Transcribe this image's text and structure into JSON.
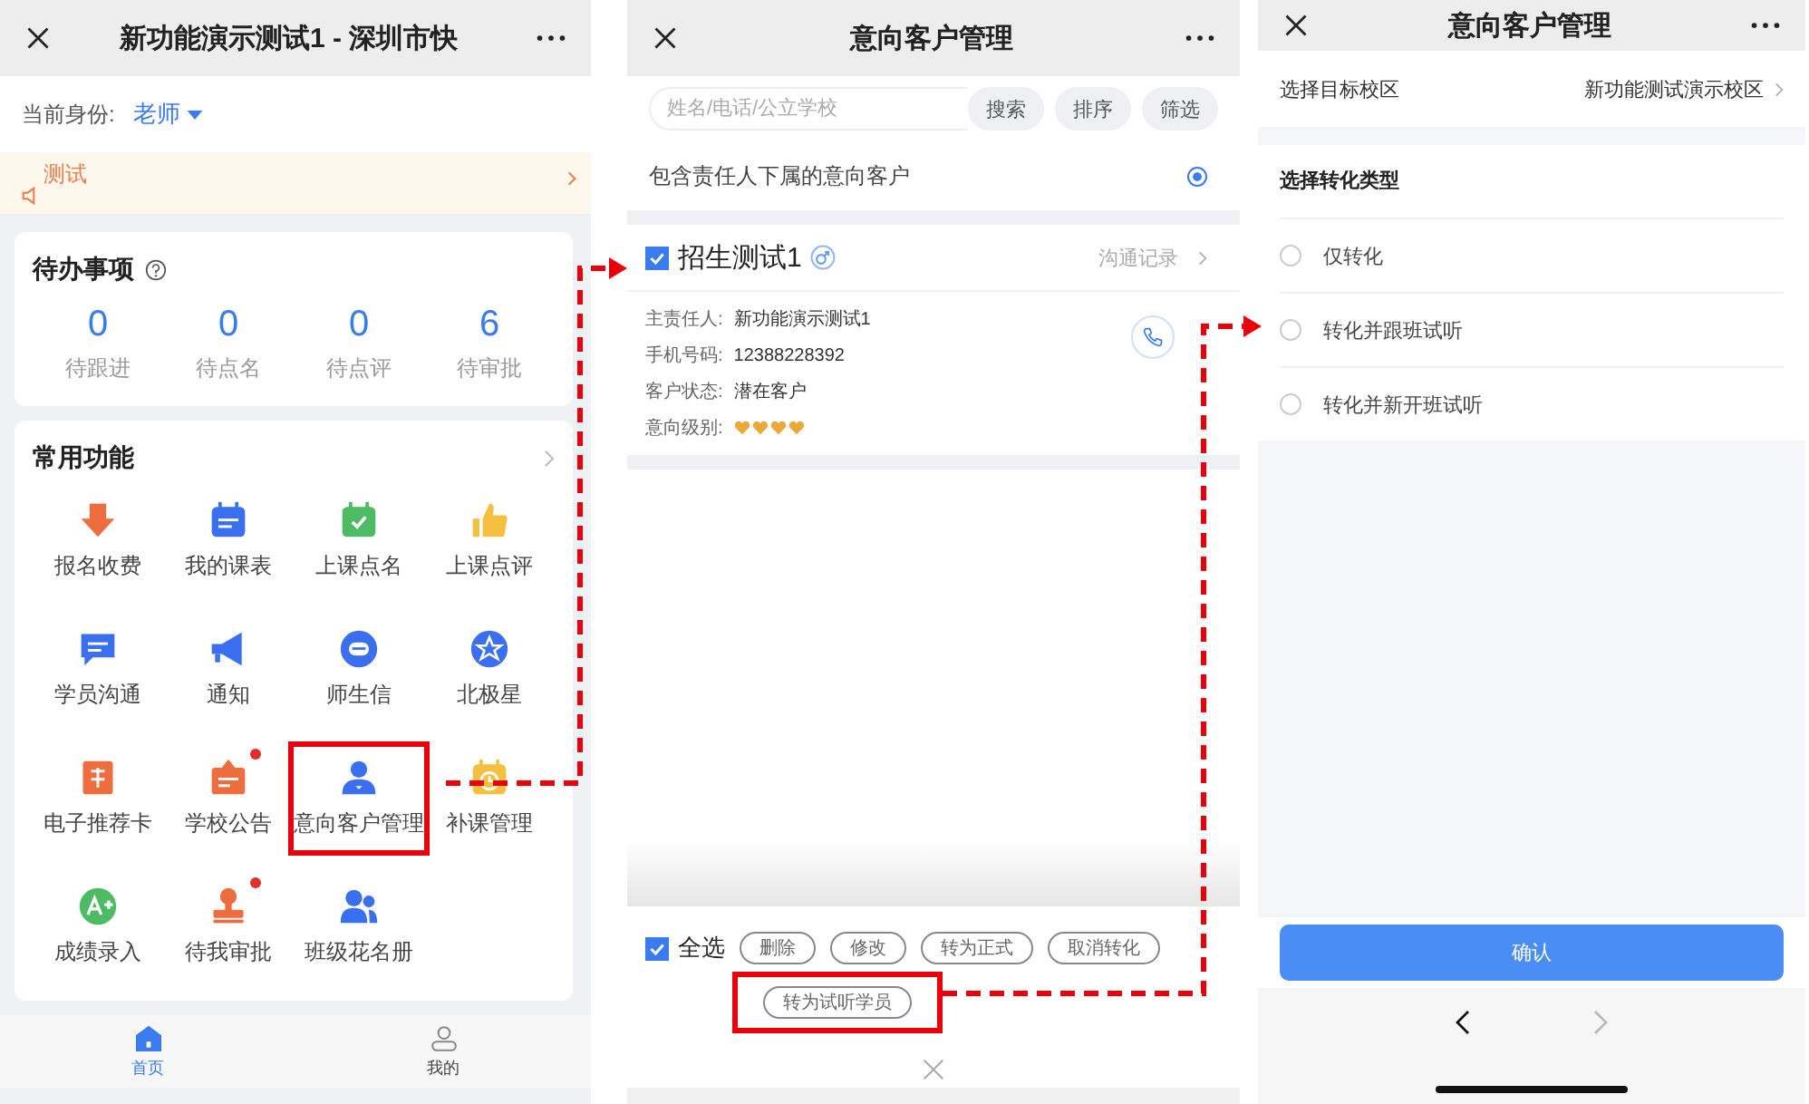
{
  "home_screen": {
    "title": "新功能演示测试1 - 深圳市快",
    "identity_label": "当前身份:",
    "identity_value": "老师",
    "notice": "测试",
    "todo": {
      "title": "待办事项",
      "stats": [
        {
          "value": "0",
          "label": "待跟进"
        },
        {
          "value": "0",
          "label": "待点名"
        },
        {
          "value": "0",
          "label": "待点评"
        },
        {
          "value": "6",
          "label": "待审批"
        }
      ]
    },
    "functions": {
      "title": "常用功能",
      "items": [
        {
          "label": "报名收费",
          "kind": "fee",
          "badge": false,
          "highlighted": false
        },
        {
          "label": "我的课表",
          "kind": "schedule",
          "badge": false,
          "highlighted": false
        },
        {
          "label": "上课点名",
          "kind": "attendance",
          "badge": false,
          "highlighted": false
        },
        {
          "label": "上课点评",
          "kind": "review",
          "badge": false,
          "highlighted": false
        },
        {
          "label": "学员沟通",
          "kind": "chat",
          "badge": false,
          "highlighted": false
        },
        {
          "label": "通知",
          "kind": "notice",
          "badge": false,
          "highlighted": false
        },
        {
          "label": "师生信",
          "kind": "message",
          "badge": false,
          "highlighted": false
        },
        {
          "label": "北极星",
          "kind": "star",
          "badge": false,
          "highlighted": false
        },
        {
          "label": "电子推荐卡",
          "kind": "card",
          "badge": false,
          "highlighted": false
        },
        {
          "label": "学校公告",
          "kind": "board",
          "badge": true,
          "highlighted": false
        },
        {
          "label": "意向客户管理",
          "kind": "person",
          "badge": false,
          "highlighted": true
        },
        {
          "label": "补课管理",
          "kind": "clock",
          "badge": false,
          "highlighted": false
        },
        {
          "label": "成绩录入",
          "kind": "grade",
          "badge": false,
          "highlighted": false
        },
        {
          "label": "待我审批",
          "kind": "stamp",
          "badge": true,
          "highlighted": false
        },
        {
          "label": "班级花名册",
          "kind": "people",
          "badge": false,
          "highlighted": false
        }
      ]
    },
    "tab_bar": [
      {
        "label": "首页",
        "selected": true
      },
      {
        "label": "我的",
        "selected": false
      }
    ]
  },
  "customer_list_screen": {
    "title": "意向客户管理",
    "search": {
      "placeholder": "姓名/电话/公立学校",
      "button": "搜索"
    },
    "tools": [
      "排序",
      "筛选"
    ],
    "include_subordinates": {
      "label": "包含责任人下属的意向客户",
      "on": true
    },
    "customers": [
      {
        "name": "招生测试1",
        "checked": true,
        "link": "沟通记录",
        "fields": [
          {
            "kind": "text",
            "label": "主责任人:",
            "value": "新功能演示测试1"
          },
          {
            "kind": "text",
            "label": "手机号码:",
            "value": "12388228392"
          },
          {
            "kind": "text",
            "label": "客户状态:",
            "value": "潜在客户"
          },
          {
            "kind": "rating",
            "label": "意向级别:",
            "stars": 4
          }
        ]
      }
    ],
    "bulk_bar": {
      "select_all": {
        "label": "全选",
        "checked": true
      },
      "actions": [
        {
          "label": "删除",
          "highlighted": false
        },
        {
          "label": "修改",
          "highlighted": false
        },
        {
          "label": "转为正式",
          "highlighted": false
        },
        {
          "label": "取消转化",
          "highlighted": false
        },
        {
          "label": "转为试听学员",
          "highlighted": true
        }
      ]
    }
  },
  "conversion_screen": {
    "title": "意向客户管理",
    "campus": {
      "label": "选择目标校区",
      "value": "新功能测试演示校区"
    },
    "type_title": "选择转化类型",
    "options": [
      {
        "label": "仅转化",
        "selected": false
      },
      {
        "label": "转化并跟班试听",
        "selected": false
      },
      {
        "label": "转化并新开班试听",
        "selected": false
      }
    ],
    "confirm": "确认",
    "nav": {
      "back_enabled": true,
      "forward_enabled": false
    }
  }
}
